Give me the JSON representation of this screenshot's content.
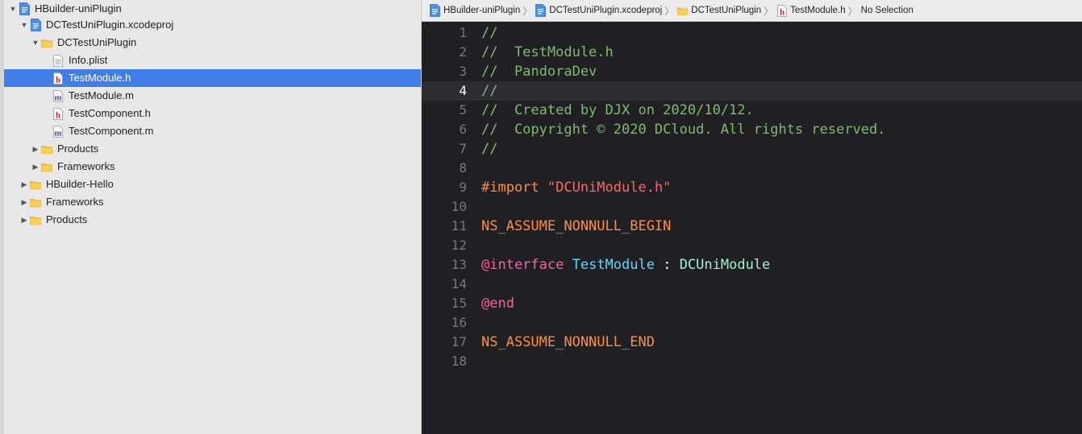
{
  "navigator": {
    "items": [
      {
        "label": "HBuilder-uniPlugin",
        "depth": 0,
        "disclosure": "open",
        "icon": "project-file-icon",
        "selected": false
      },
      {
        "label": "DCTestUniPlugin.xcodeproj",
        "depth": 1,
        "disclosure": "open",
        "icon": "project-file-icon",
        "selected": false
      },
      {
        "label": "DCTestUniPlugin",
        "depth": 2,
        "disclosure": "open",
        "icon": "folder-icon",
        "selected": false
      },
      {
        "label": "Info.plist",
        "depth": 3,
        "disclosure": "none",
        "icon": "plist-file-icon",
        "selected": false
      },
      {
        "label": "TestModule.h",
        "depth": 3,
        "disclosure": "none",
        "icon": "header-file-icon",
        "selected": true
      },
      {
        "label": "TestModule.m",
        "depth": 3,
        "disclosure": "none",
        "icon": "implementation-file-icon",
        "selected": false
      },
      {
        "label": "TestComponent.h",
        "depth": 3,
        "disclosure": "none",
        "icon": "header-file-icon",
        "selected": false
      },
      {
        "label": "TestComponent.m",
        "depth": 3,
        "disclosure": "none",
        "icon": "implementation-file-icon",
        "selected": false
      },
      {
        "label": "Products",
        "depth": 2,
        "disclosure": "closed",
        "icon": "folder-icon",
        "selected": false
      },
      {
        "label": "Frameworks",
        "depth": 2,
        "disclosure": "closed",
        "icon": "folder-icon",
        "selected": false
      },
      {
        "label": "HBuilder-Hello",
        "depth": 1,
        "disclosure": "closed",
        "icon": "folder-icon",
        "selected": false
      },
      {
        "label": "Frameworks",
        "depth": 1,
        "disclosure": "closed",
        "icon": "folder-icon",
        "selected": false
      },
      {
        "label": "Products",
        "depth": 1,
        "disclosure": "closed",
        "icon": "folder-icon",
        "selected": false
      }
    ]
  },
  "jump_bar": {
    "crumbs": [
      {
        "label": "HBuilder-uniPlugin",
        "icon": "project-file-icon"
      },
      {
        "label": "DCTestUniPlugin.xcodeproj",
        "icon": "project-file-icon"
      },
      {
        "label": "DCTestUniPlugin",
        "icon": "folder-icon"
      },
      {
        "label": "TestModule.h",
        "icon": "header-file-icon"
      },
      {
        "label": "No Selection",
        "icon": ""
      }
    ]
  },
  "editor": {
    "current_line": 4,
    "lines": [
      {
        "n": "1",
        "tokens": [
          {
            "t": "//",
            "c": "comment"
          }
        ]
      },
      {
        "n": "2",
        "tokens": [
          {
            "t": "//  TestModule.h",
            "c": "comment"
          }
        ]
      },
      {
        "n": "3",
        "tokens": [
          {
            "t": "//  PandoraDev",
            "c": "comment"
          }
        ]
      },
      {
        "n": "4",
        "tokens": [
          {
            "t": "//",
            "c": "comment"
          }
        ]
      },
      {
        "n": "5",
        "tokens": [
          {
            "t": "//  Created by DJX on 2020/10/12.",
            "c": "comment"
          }
        ]
      },
      {
        "n": "6",
        "tokens": [
          {
            "t": "//  Copyright © 2020 DCloud. All rights reserved.",
            "c": "comment"
          }
        ]
      },
      {
        "n": "7",
        "tokens": [
          {
            "t": "//",
            "c": "comment"
          }
        ]
      },
      {
        "n": "8",
        "tokens": []
      },
      {
        "n": "9",
        "tokens": [
          {
            "t": "#import ",
            "c": "preproc"
          },
          {
            "t": "\"DCUniModule.h\"",
            "c": "string"
          }
        ]
      },
      {
        "n": "10",
        "tokens": []
      },
      {
        "n": "11",
        "tokens": [
          {
            "t": "NS_ASSUME_NONNULL_BEGIN",
            "c": "macro"
          }
        ]
      },
      {
        "n": "12",
        "tokens": []
      },
      {
        "n": "13",
        "tokens": [
          {
            "t": "@interface",
            "c": "keyword"
          },
          {
            "t": " ",
            "c": "plain"
          },
          {
            "t": "TestModule",
            "c": "type-decl"
          },
          {
            "t": " : ",
            "c": "plain"
          },
          {
            "t": "DCUniModule",
            "c": "type"
          }
        ]
      },
      {
        "n": "14",
        "tokens": []
      },
      {
        "n": "15",
        "tokens": [
          {
            "t": "@end",
            "c": "keyword"
          }
        ]
      },
      {
        "n": "16",
        "tokens": []
      },
      {
        "n": "17",
        "tokens": [
          {
            "t": "NS_ASSUME_NONNULL_END",
            "c": "macro"
          }
        ]
      },
      {
        "n": "18",
        "tokens": []
      }
    ]
  },
  "colors": {
    "selection": "#3f7ee8",
    "editor_bg": "#1f1f24",
    "comment": "#7cbd6a",
    "keyword": "#fc5fa3",
    "preproc": "#fd8f3f",
    "string": "#fc6a5d"
  }
}
